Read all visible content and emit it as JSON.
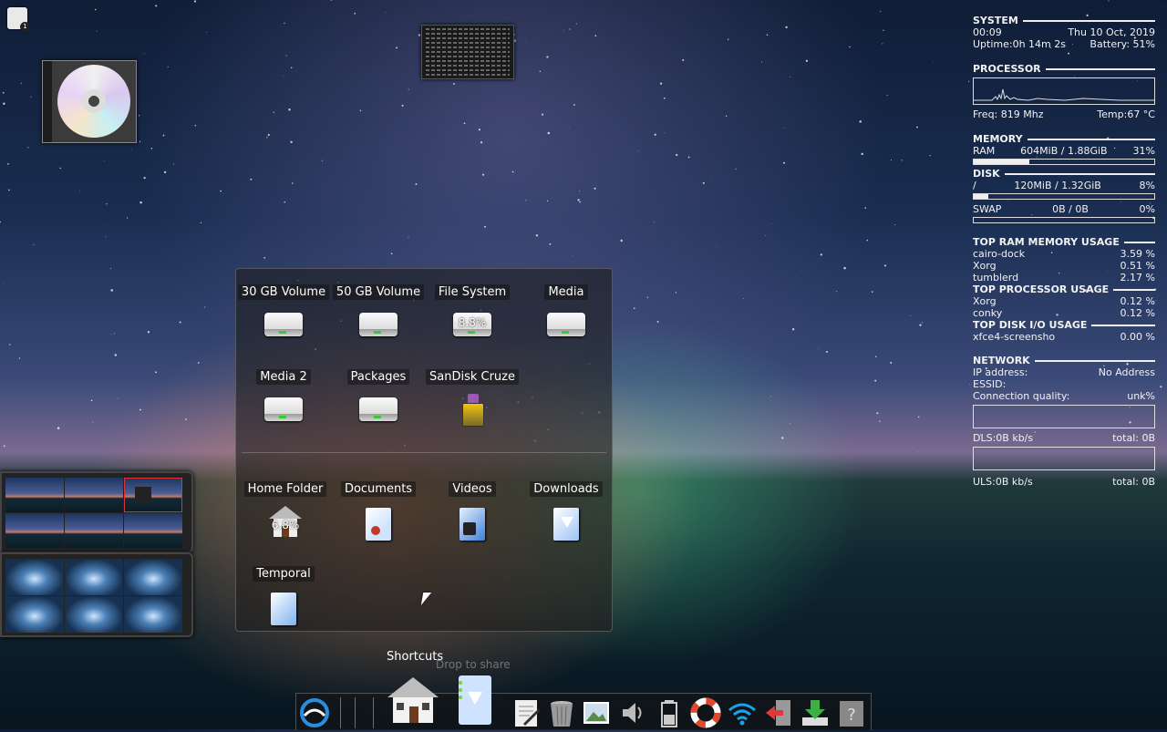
{
  "desktop": {
    "corner_icon": "notes-icon",
    "corner_badge": "1",
    "cd_icon": "cd-icon",
    "terminal_thumb": "terminal-window-thumbnail"
  },
  "conky": {
    "system": {
      "title": "SYSTEM",
      "time": "00:09",
      "date": "Thu 10 Oct, 2019",
      "uptime": "Uptime:0h 14m 2s",
      "battery": "Battery: 51%"
    },
    "processor": {
      "title": "PROCESSOR",
      "freq": "Freq: 819 Mhz",
      "temp": "Temp:67 °C"
    },
    "memory": {
      "title": "MEMORY",
      "ram_label": "RAM",
      "ram_value": "604MiB / 1.88GiB",
      "ram_pct": "31%",
      "ram_fraction": 0.31
    },
    "disk": {
      "title": "DISK",
      "root_label": "/",
      "root_value": "120MiB / 1.32GiB",
      "root_pct": "8%",
      "root_fraction": 0.08,
      "swap_label": "SWAP",
      "swap_value": "0B  / 0B",
      "swap_pct": "0%",
      "swap_fraction": 0
    },
    "top_ram": {
      "title": "TOP RAM MEMORY USAGE",
      "rows": [
        {
          "name": "cairo-dock",
          "value": "3.59 %"
        },
        {
          "name": "Xorg",
          "value": "0.51 %"
        },
        {
          "name": "tumblerd",
          "value": "2.17 %"
        }
      ]
    },
    "top_cpu": {
      "title": "TOP PROCESSOR USAGE",
      "rows": [
        {
          "name": "Xorg",
          "value": "0.12 %"
        },
        {
          "name": "conky",
          "value": "0.12 %"
        }
      ]
    },
    "top_io": {
      "title": "TOP DISK I/O USAGE",
      "rows": [
        {
          "name": "xfce4-screensho",
          "value": "0.00 %"
        }
      ]
    },
    "network": {
      "title": "NETWORK",
      "ip_label": "IP address:",
      "ip_value": "No Address",
      "essid_label": "ESSID:",
      "quality_label": "Connection quality:",
      "quality_value": "unk%",
      "dls": "DLS:0B   kb/s",
      "dls_total": "total: 0B",
      "uls": "ULS:0B   kb/s",
      "uls_total": "total: 0B"
    }
  },
  "shortcuts_panel": {
    "title": "Shortcuts",
    "drop_hint": "Drop to share",
    "drives": [
      {
        "label": "30 GB Volume",
        "icon": "drive-icon"
      },
      {
        "label": "50 GB Volume",
        "icon": "drive-icon"
      },
      {
        "label": "File System",
        "icon": "drive-icon",
        "usage": "8.8%"
      },
      {
        "label": "Media",
        "icon": "drive-icon"
      },
      {
        "label": "Media 2",
        "icon": "drive-icon"
      },
      {
        "label": "Packages",
        "icon": "drive-icon"
      },
      {
        "label": "SanDisk Cruze",
        "icon": "usb-drive-icon"
      }
    ],
    "folders": [
      {
        "label": "Home Folder",
        "icon": "home-folder-icon",
        "usage": "6.8%"
      },
      {
        "label": "Documents",
        "icon": "documents-folder-icon"
      },
      {
        "label": "Videos",
        "icon": "videos-folder-icon"
      },
      {
        "label": "Downloads",
        "icon": "downloads-folder-icon"
      },
      {
        "label": "Temporal",
        "icon": "temp-folder-icon"
      }
    ]
  },
  "dock": {
    "items": [
      "app-menu-icon",
      "shortcuts-home-icon",
      "downloads-icon",
      "text-editor-icon",
      "trash-icon",
      "image-viewer-icon",
      "volume-icon",
      "battery-icon",
      "help-lifebuoy-icon",
      "wifi-icon",
      "logout-icon",
      "download-manager-icon",
      "unknown-app-icon"
    ]
  },
  "colors": {
    "accent_red": "#d33333",
    "conky_text": "#f2f2f2",
    "panel_bg": "rgba(30,30,30,0.62)"
  }
}
